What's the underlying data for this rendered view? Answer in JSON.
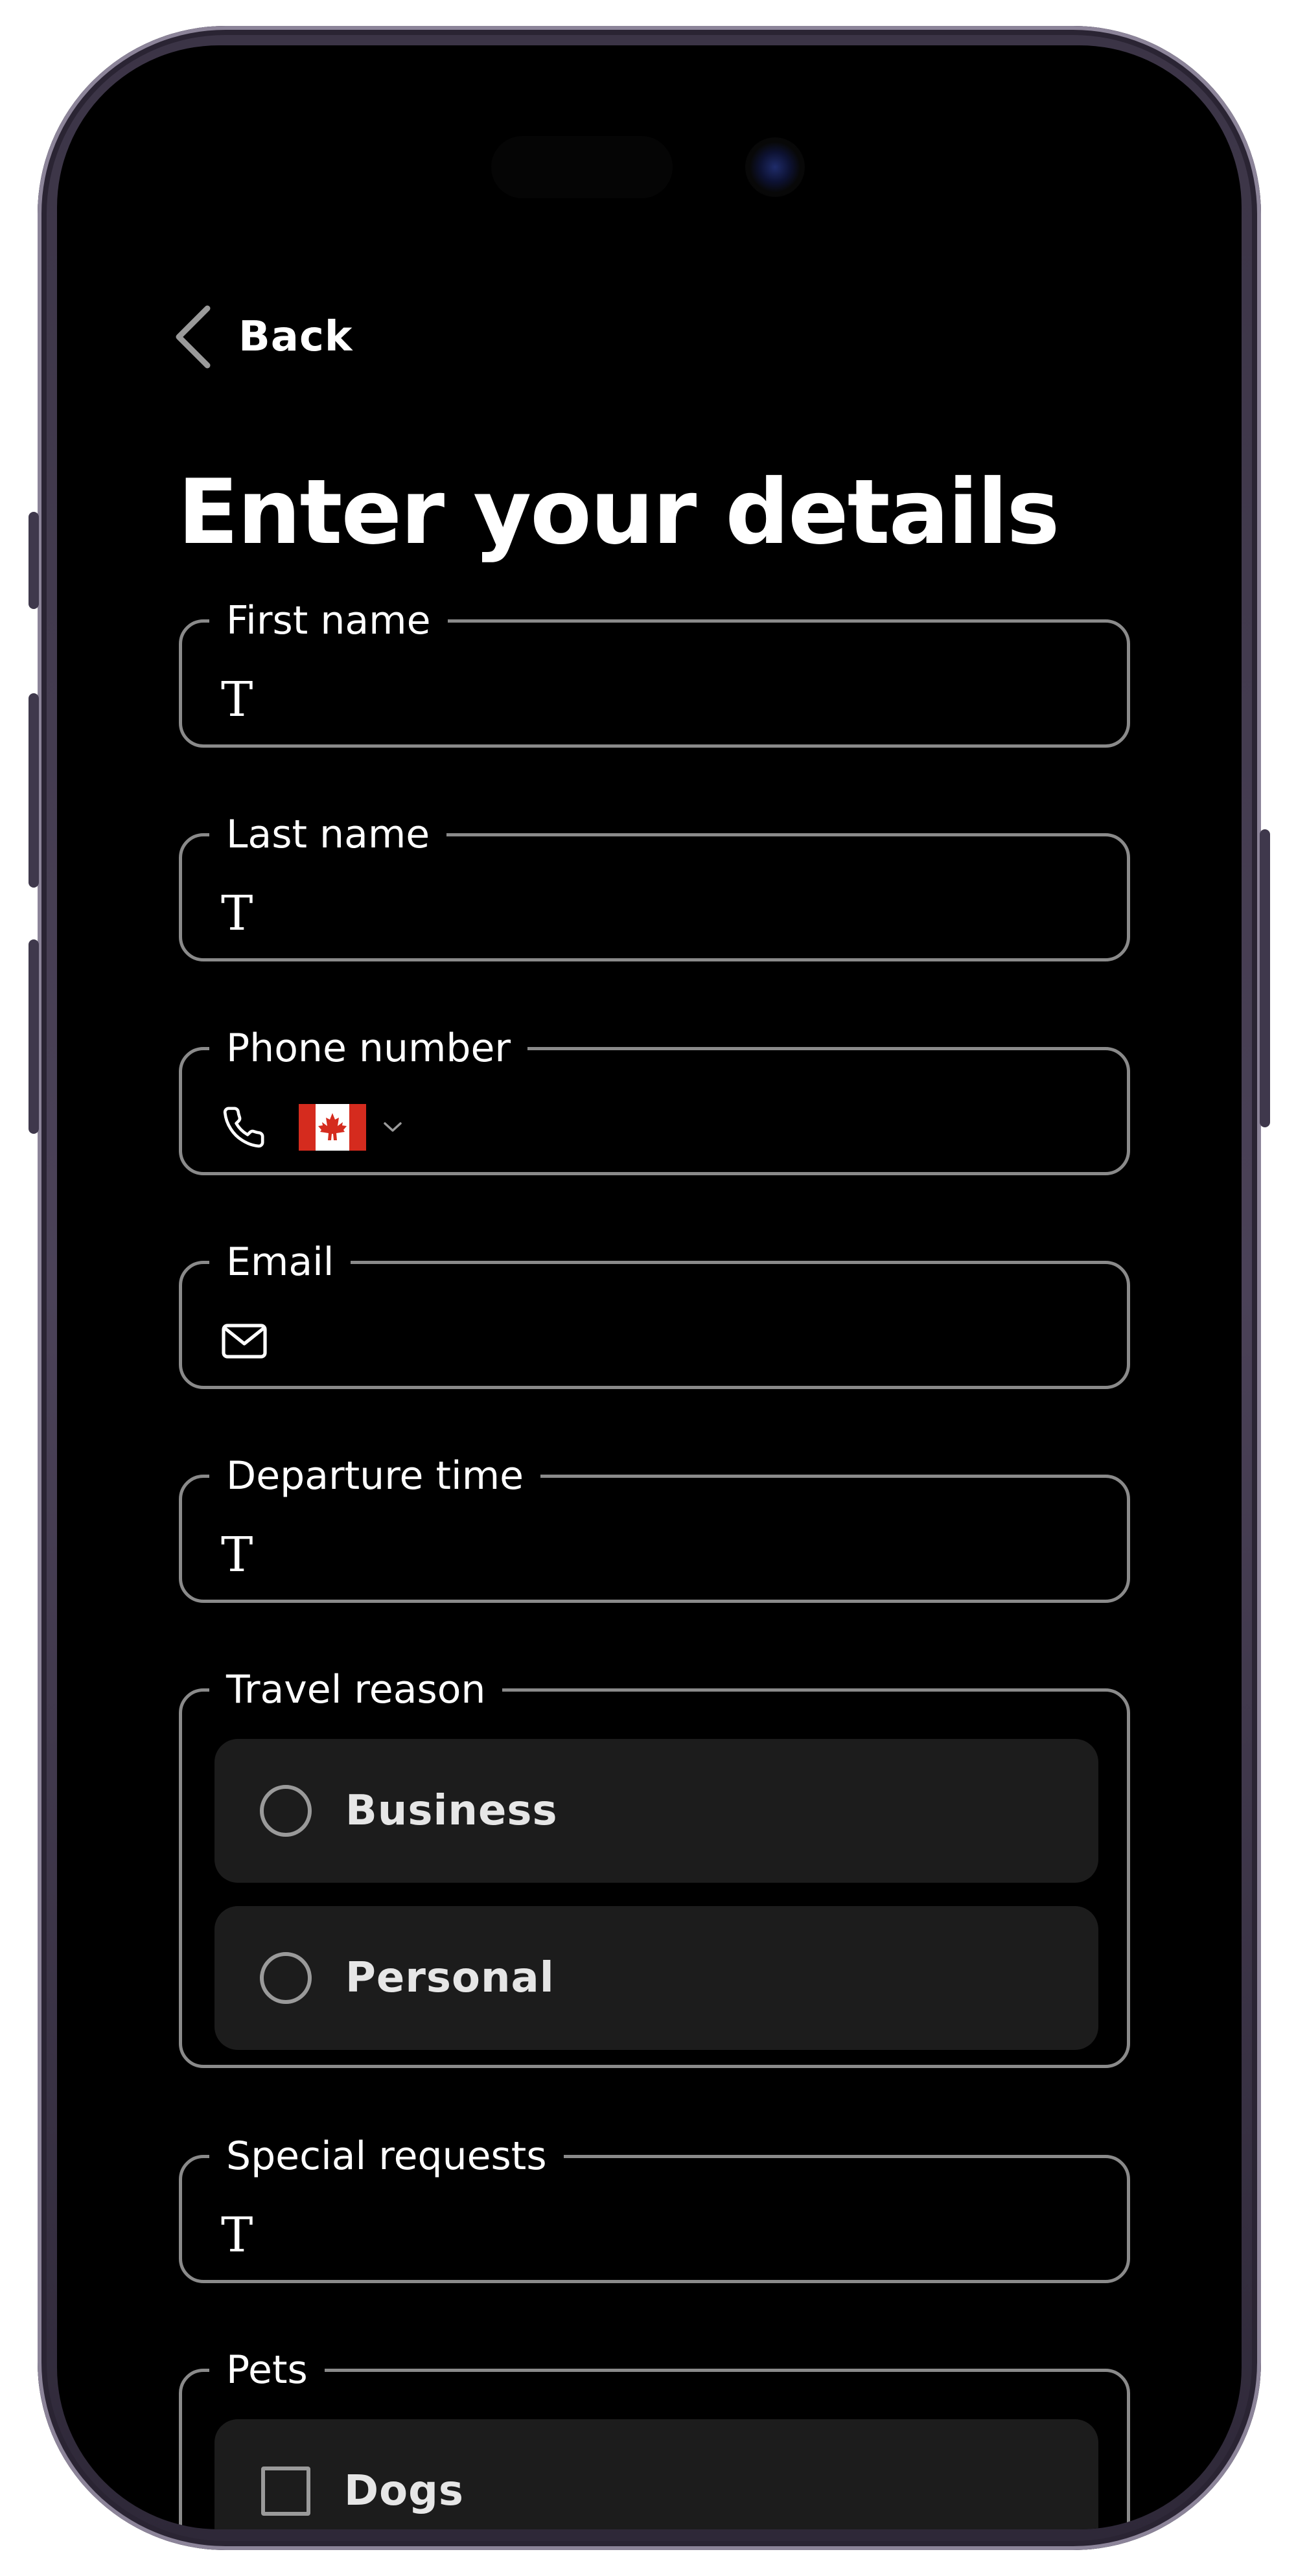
{
  "nav": {
    "back_label": "Back"
  },
  "page": {
    "title": "Enter your details"
  },
  "form": {
    "first_name": {
      "label": "First name",
      "icon": "text-icon",
      "icon_glyph": "T",
      "value": ""
    },
    "last_name": {
      "label": "Last name",
      "icon": "text-icon",
      "icon_glyph": "T",
      "value": ""
    },
    "phone_number": {
      "label": "Phone number",
      "icon": "phone-icon",
      "country_flag": "canada-flag-icon",
      "value": ""
    },
    "email": {
      "label": "Email",
      "icon": "mail-icon",
      "value": ""
    },
    "departure_time": {
      "label": "Departure time",
      "icon": "text-icon",
      "icon_glyph": "T",
      "value": ""
    },
    "travel_reason": {
      "label": "Travel reason",
      "options": [
        {
          "label": "Business",
          "selected": false
        },
        {
          "label": "Personal",
          "selected": false
        }
      ]
    },
    "special_requests": {
      "label": "Special requests",
      "icon": "text-icon",
      "icon_glyph": "T",
      "value": ""
    },
    "pets": {
      "label": "Pets",
      "options": [
        {
          "label": "Dogs",
          "checked": false
        }
      ]
    }
  },
  "colors": {
    "background": "#000000",
    "field_border": "#8a8a8a",
    "option_background": "#1c1c1c",
    "text": "#ffffff",
    "flag_red": "#d52b1e"
  }
}
